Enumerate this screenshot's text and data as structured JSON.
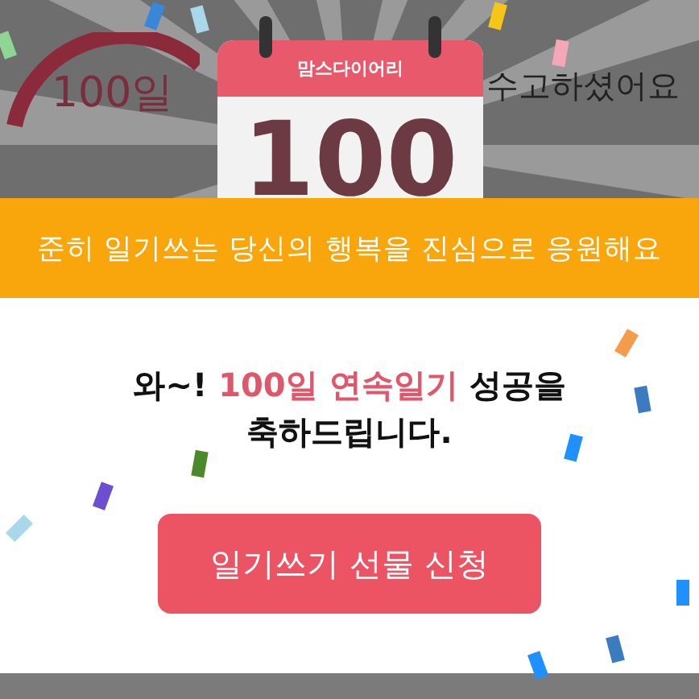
{
  "background": {
    "counter_label": "100일",
    "message": "수고하셨어요"
  },
  "calendar": {
    "brand": "맘스다이어리",
    "number": "100"
  },
  "banner": {
    "text": "준히 일기쓰는 당신의 행복을 진심으로 응원해요"
  },
  "popup": {
    "title_lines": [
      [
        {
          "text": "와~! ",
          "highlight": false
        },
        {
          "text": "100일 연속일기",
          "highlight": true
        },
        {
          "text": " 성공을",
          "highlight": false
        }
      ],
      [
        {
          "text": "축하드립니다.",
          "highlight": false
        }
      ]
    ],
    "button": {
      "label": "일기쓰기 선물 신청"
    }
  }
}
